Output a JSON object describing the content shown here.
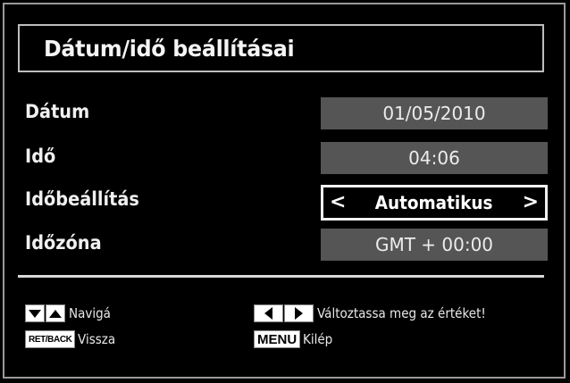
{
  "header": {
    "title": "Dátum/idő beállításai"
  },
  "settings": [
    {
      "label": "Dátum",
      "value": "01/05/2010",
      "selected": false
    },
    {
      "label": "Idő",
      "value": "04:06",
      "selected": false
    },
    {
      "label": "Időbeállítás",
      "value": "Automatikus",
      "selected": true
    },
    {
      "label": "Időzóna",
      "value": "GMT + 00:00",
      "selected": false
    }
  ],
  "selector": {
    "left_arrow": "<",
    "right_arrow": ">"
  },
  "legend": {
    "navigate_label": "Navigá",
    "back_key": "RET/BACK",
    "back_label": "Vissza",
    "change_label": "Változtassa meg az értéket!",
    "menu_key": "MENU",
    "menu_label": "Kilép"
  },
  "colors": {
    "background": "#000000",
    "value_box": "#555555",
    "text": "#f0f0f0",
    "selected_border": "#f0f0f0"
  }
}
